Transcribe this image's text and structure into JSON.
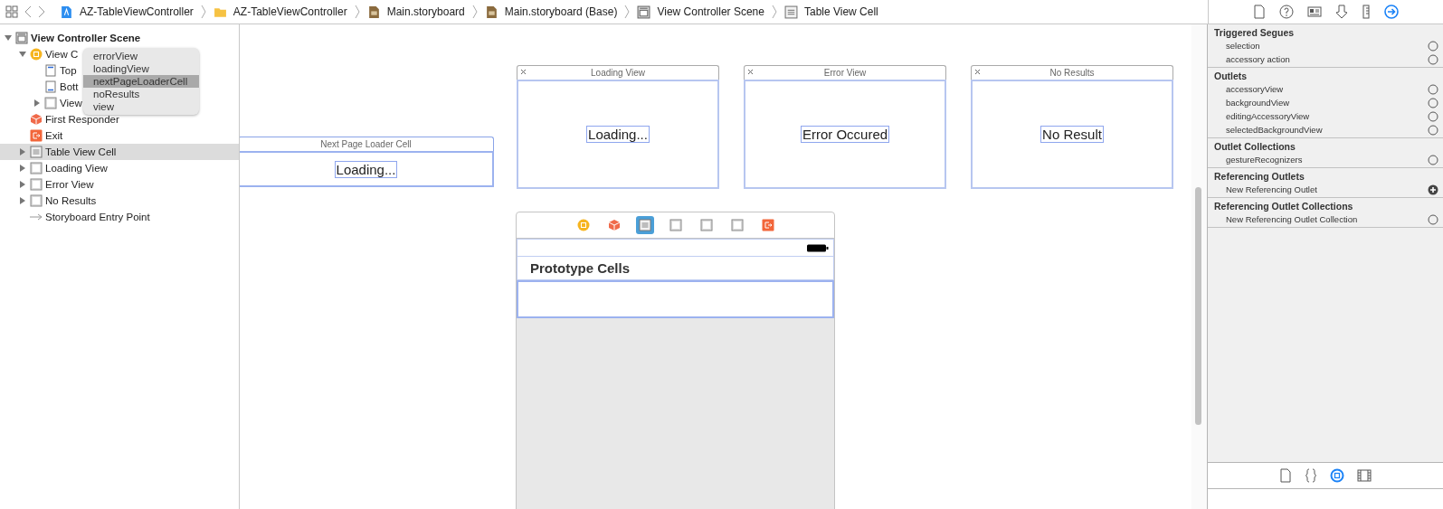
{
  "toolbar": {
    "nav": [
      {
        "kind": "grid"
      },
      {
        "kind": "back"
      },
      {
        "kind": "forward"
      }
    ],
    "breadcrumbs": [
      {
        "label": "AZ-TableViewController",
        "kind": "project"
      },
      {
        "label": "AZ-TableViewController",
        "kind": "folder"
      },
      {
        "label": "Main.storyboard",
        "kind": "storyboard"
      },
      {
        "label": "Main.storyboard (Base)",
        "kind": "storyboard"
      },
      {
        "label": "View Controller Scene",
        "kind": "scene"
      },
      {
        "label": "Table View Cell",
        "kind": "cell"
      }
    ]
  },
  "outline": [
    {
      "label": "View Controller Scene",
      "kind": "scene",
      "expanded": true,
      "selected": false,
      "children": [
        {
          "label": "View C",
          "kind": "view-controller",
          "expanded": true,
          "selected": false,
          "children": [
            {
              "label": "Top",
              "kind": "guide-top",
              "selected": false
            },
            {
              "label": "Bott",
              "kind": "guide-bottom",
              "selected": false
            },
            {
              "label": "View",
              "kind": "view",
              "expanded": false,
              "selected": false
            }
          ]
        },
        {
          "label": "First Responder",
          "kind": "first-responder",
          "selected": false
        },
        {
          "label": "Exit",
          "kind": "exit",
          "selected": false
        },
        {
          "label": "Table View Cell",
          "kind": "cell",
          "expanded": false,
          "selected": true
        },
        {
          "label": "Loading View",
          "kind": "view",
          "expanded": false,
          "selected": false
        },
        {
          "label": "Error View",
          "kind": "view",
          "expanded": false,
          "selected": false
        },
        {
          "label": "No Results",
          "kind": "view",
          "expanded": false,
          "selected": false
        },
        {
          "label": "Storyboard Entry Point",
          "kind": "entry",
          "selected": false
        }
      ]
    }
  ],
  "popup_menu": [
    {
      "label": "errorView",
      "selected": false
    },
    {
      "label": "loadingView",
      "selected": false
    },
    {
      "label": "nextPageLoaderCell",
      "selected": true
    },
    {
      "label": "noResults",
      "selected": false
    },
    {
      "label": "view",
      "selected": false
    }
  ],
  "canvas": {
    "views": [
      {
        "title": "Next Page Loader Cell",
        "label": "Loading...",
        "kind": "cell"
      },
      {
        "title": "Loading View",
        "label": "Loading...",
        "kind": "view"
      },
      {
        "title": "Error View",
        "label": "Error Occured",
        "kind": "view"
      },
      {
        "title": "No Results",
        "label": "No Result",
        "kind": "view"
      }
    ],
    "scene": {
      "dock": [
        {
          "kind": "view-controller",
          "selected": false
        },
        {
          "kind": "first-responder",
          "selected": false
        },
        {
          "kind": "cell",
          "selected": true
        },
        {
          "kind": "view",
          "selected": false
        },
        {
          "kind": "view",
          "selected": false
        },
        {
          "kind": "view",
          "selected": false
        },
        {
          "kind": "exit",
          "selected": false
        }
      ],
      "table_header": "Prototype Cells"
    }
  },
  "inspector": {
    "tabs": [
      {
        "kind": "file",
        "selected": false
      },
      {
        "kind": "help",
        "selected": false
      },
      {
        "kind": "identity",
        "selected": false
      },
      {
        "kind": "attributes",
        "selected": false
      },
      {
        "kind": "size",
        "selected": false
      },
      {
        "kind": "connections",
        "selected": true
      }
    ],
    "sections": [
      {
        "title": "Triggered Segues",
        "rows": [
          {
            "label": "selection",
            "kind": "empty"
          },
          {
            "label": "accessory action",
            "kind": "empty"
          }
        ]
      },
      {
        "title": "Outlets",
        "rows": [
          {
            "label": "accessoryView",
            "kind": "empty"
          },
          {
            "label": "backgroundView",
            "kind": "empty"
          },
          {
            "label": "editingAccessoryView",
            "kind": "empty"
          },
          {
            "label": "selectedBackgroundView",
            "kind": "empty"
          }
        ]
      },
      {
        "title": "Outlet Collections",
        "rows": [
          {
            "label": "gestureRecognizers",
            "kind": "empty"
          }
        ]
      },
      {
        "title": "Referencing Outlets",
        "rows": [
          {
            "label": "New Referencing Outlet",
            "kind": "add"
          }
        ]
      },
      {
        "title": "Referencing Outlet Collections",
        "rows": [
          {
            "label": "New Referencing Outlet Collection",
            "kind": "empty"
          }
        ]
      }
    ],
    "library_tabs": [
      {
        "kind": "file",
        "selected": false
      },
      {
        "kind": "code",
        "selected": false
      },
      {
        "kind": "object",
        "selected": true
      },
      {
        "kind": "media",
        "selected": false
      }
    ]
  }
}
